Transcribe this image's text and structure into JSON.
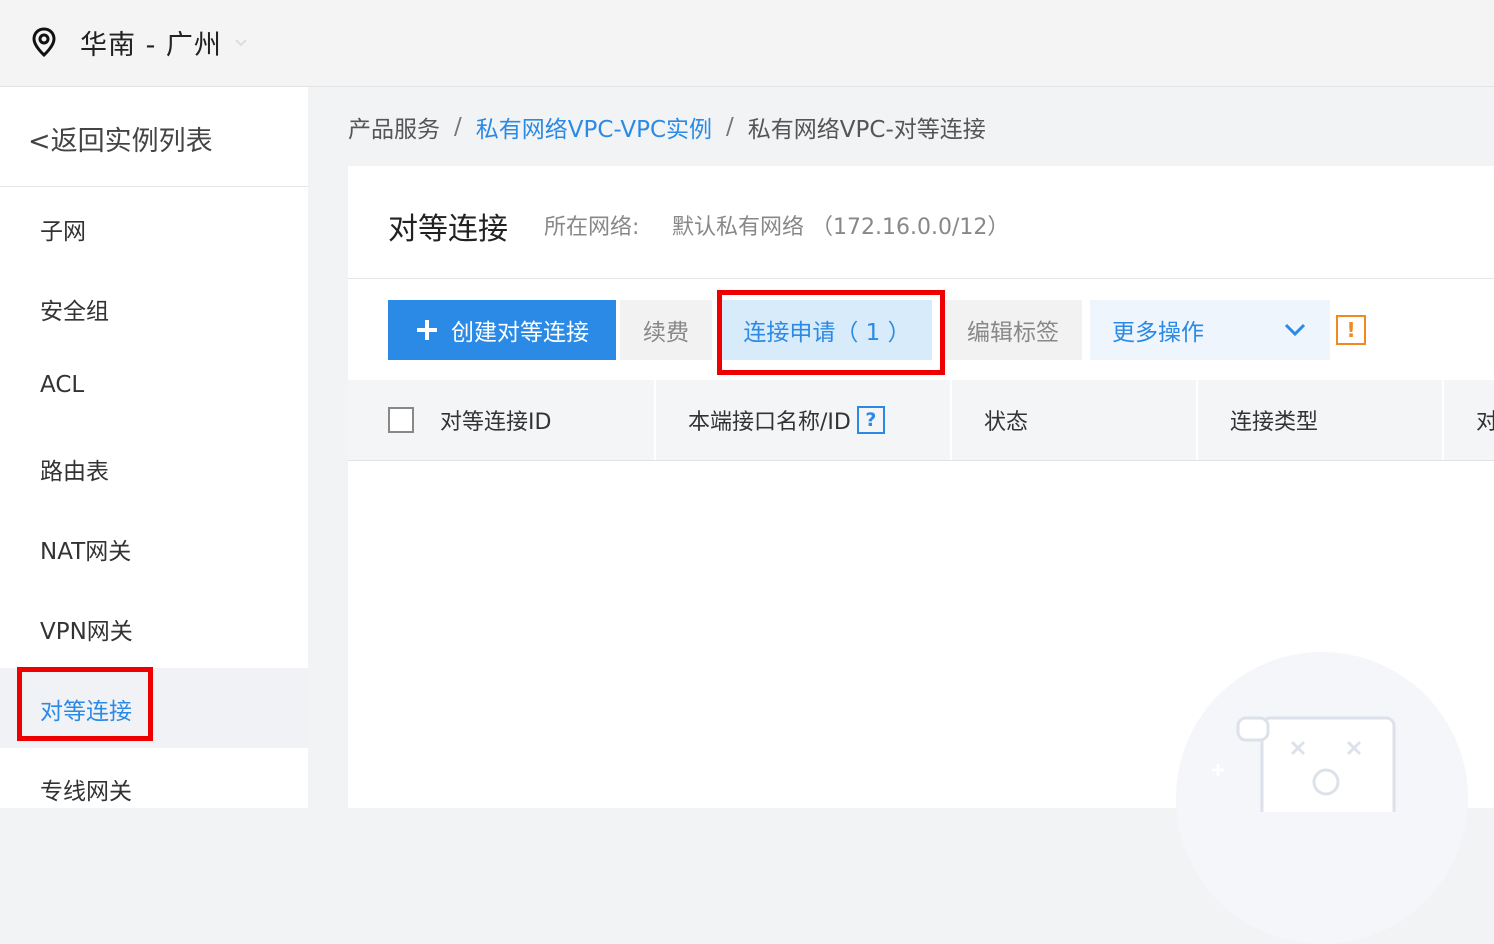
{
  "region": {
    "label": "华南 - 广州"
  },
  "sidebar": {
    "back_label": "<返回实例列表",
    "items": [
      {
        "label": "子网"
      },
      {
        "label": "安全组"
      },
      {
        "label": "ACL"
      },
      {
        "label": "路由表"
      },
      {
        "label": "NAT网关"
      },
      {
        "label": "VPN网关"
      },
      {
        "label": "对等连接",
        "active": true
      },
      {
        "label": "专线网关"
      }
    ]
  },
  "breadcrumb": {
    "items": [
      "产品服务",
      "私有网络VPC-VPC实例",
      "私有网络VPC-对等连接"
    ],
    "separator": "/"
  },
  "panel": {
    "title": "对等连接",
    "network_label": "所在网络:",
    "network_value": "默认私有网络 （172.16.0.0/12）"
  },
  "toolbar": {
    "create_label": "创建对等连接",
    "renew_label": "续费",
    "requests_label": "连接申请（ 1 ）",
    "edit_tags_label": "编辑标签",
    "more_label": "更多操作",
    "warn_label": "!"
  },
  "table": {
    "columns": [
      "对等连接ID",
      "本端接口名称/ID",
      "状态",
      "连接类型",
      "对"
    ],
    "help_label": "?"
  },
  "colors": {
    "accent": "#2a8ae6",
    "highlight": "#e00000",
    "warning": "#f0891f"
  }
}
